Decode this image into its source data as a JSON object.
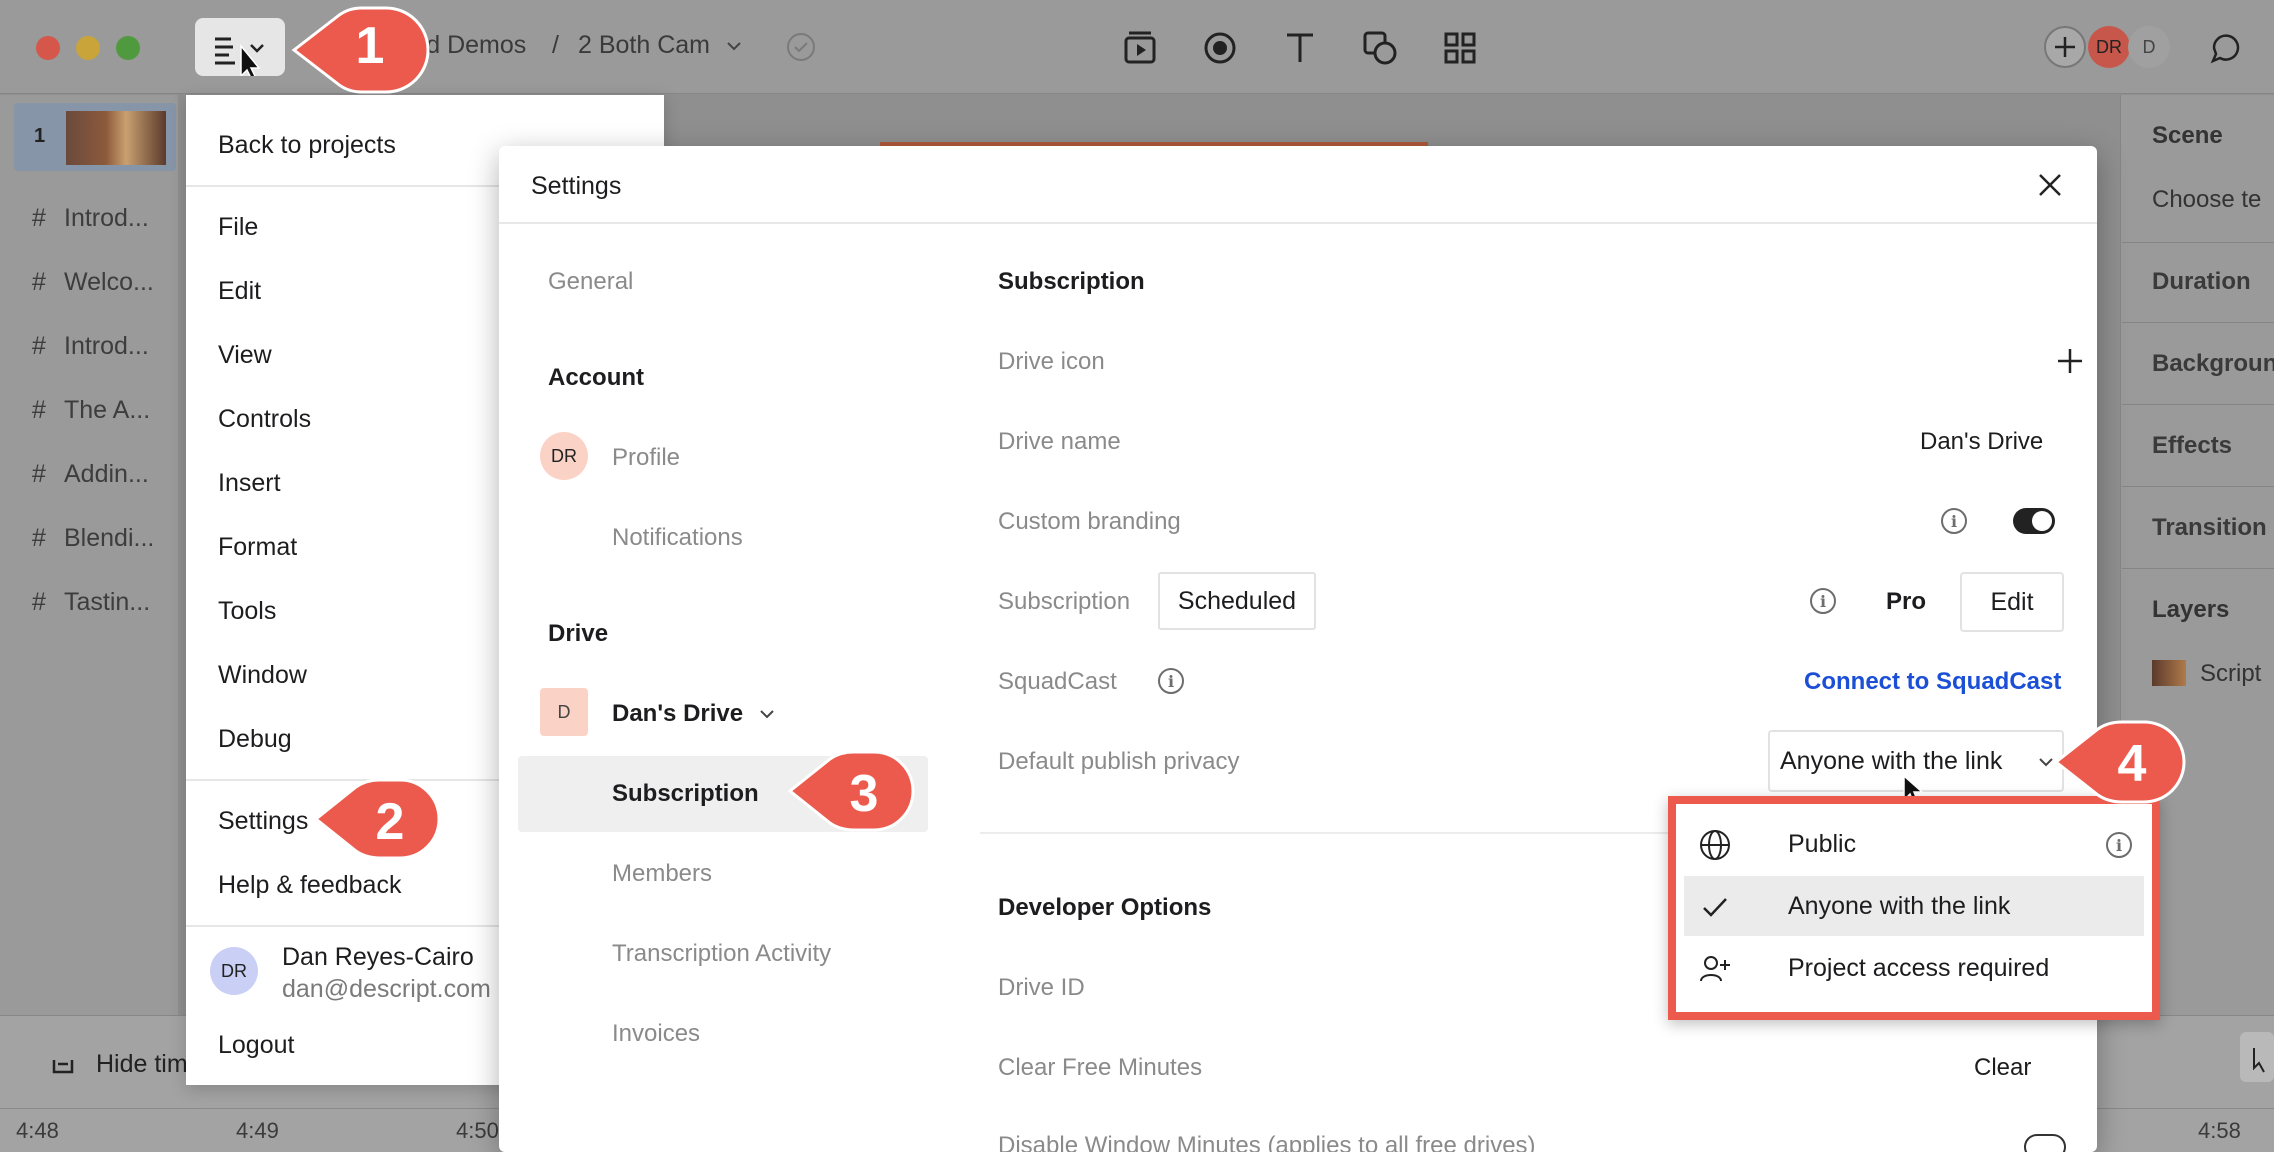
{
  "titlebar": {
    "breadcrumb_project": "ard Demos",
    "breadcrumb_sep": "/",
    "breadcrumb_doc": "2 Both Cam",
    "avatar_dr": "DR",
    "avatar_d": "D"
  },
  "script_list": {
    "scene_number": "1",
    "items": [
      "Introd...",
      "Welco...",
      "Introd...",
      "The A...",
      "Addin...",
      "Blendi...",
      "Tastin..."
    ],
    "hash": "#"
  },
  "right_panel": {
    "scene": "Scene",
    "choose": "Choose te",
    "duration": "Duration",
    "background": "Backgroun",
    "effects": "Effects",
    "transitions": "Transition",
    "layers": "Layers",
    "script": "Script"
  },
  "bottom_bar": {
    "hide_timeline": "Hide tim",
    "times": [
      "4:48",
      "4:49",
      "4:50",
      "4:58"
    ]
  },
  "menu": {
    "back": "Back to projects",
    "items": [
      "File",
      "Edit",
      "View",
      "Controls",
      "Insert",
      "Format",
      "Tools",
      "Window",
      "Debug"
    ],
    "settings": "Settings",
    "help": "Help & feedback",
    "user_initials": "DR",
    "user_name": "Dan Reyes-Cairo",
    "user_email": "dan@descript.com",
    "logout": "Logout"
  },
  "settings": {
    "title": "Settings",
    "nav": {
      "general": "General",
      "account": "Account",
      "profile_initials": "DR",
      "profile": "Profile",
      "notifications": "Notifications",
      "drive": "Drive",
      "drive_initial": "D",
      "drive_name": "Dan's Drive",
      "subscription": "Subscription",
      "members": "Members",
      "transcription": "Transcription Activity",
      "invoices": "Invoices"
    },
    "section_title": "Subscription",
    "drive_icon_label": "Drive icon",
    "drive_name_label": "Drive name",
    "drive_name_value": "Dan's Drive",
    "custom_branding_label": "Custom branding",
    "subscription_label": "Subscription",
    "subscription_status": "Scheduled",
    "plan": "Pro",
    "edit": "Edit",
    "squadcast_label": "SquadCast",
    "squadcast_link": "Connect to SquadCast",
    "privacy_label": "Default publish privacy",
    "privacy_value": "Anyone with the link",
    "dev_title": "Developer Options",
    "drive_id_label": "Drive ID",
    "clear_minutes_label": "Clear Free Minutes",
    "clear": "Clear",
    "disable_window_label": "Disable Window Minutes (applies to all free drives)"
  },
  "privacy_options": [
    {
      "label": "Public",
      "icon": "globe-icon"
    },
    {
      "label": "Anyone with the link",
      "icon": "check-icon",
      "selected": true
    },
    {
      "label": "Project access required",
      "icon": "person-plus-icon"
    }
  ],
  "callouts": [
    "1",
    "2",
    "3",
    "4"
  ],
  "colors": {
    "accent_link": "#1a4fd6",
    "callout": "#ec5a4e",
    "highlight_border": "#ec5a4e"
  }
}
